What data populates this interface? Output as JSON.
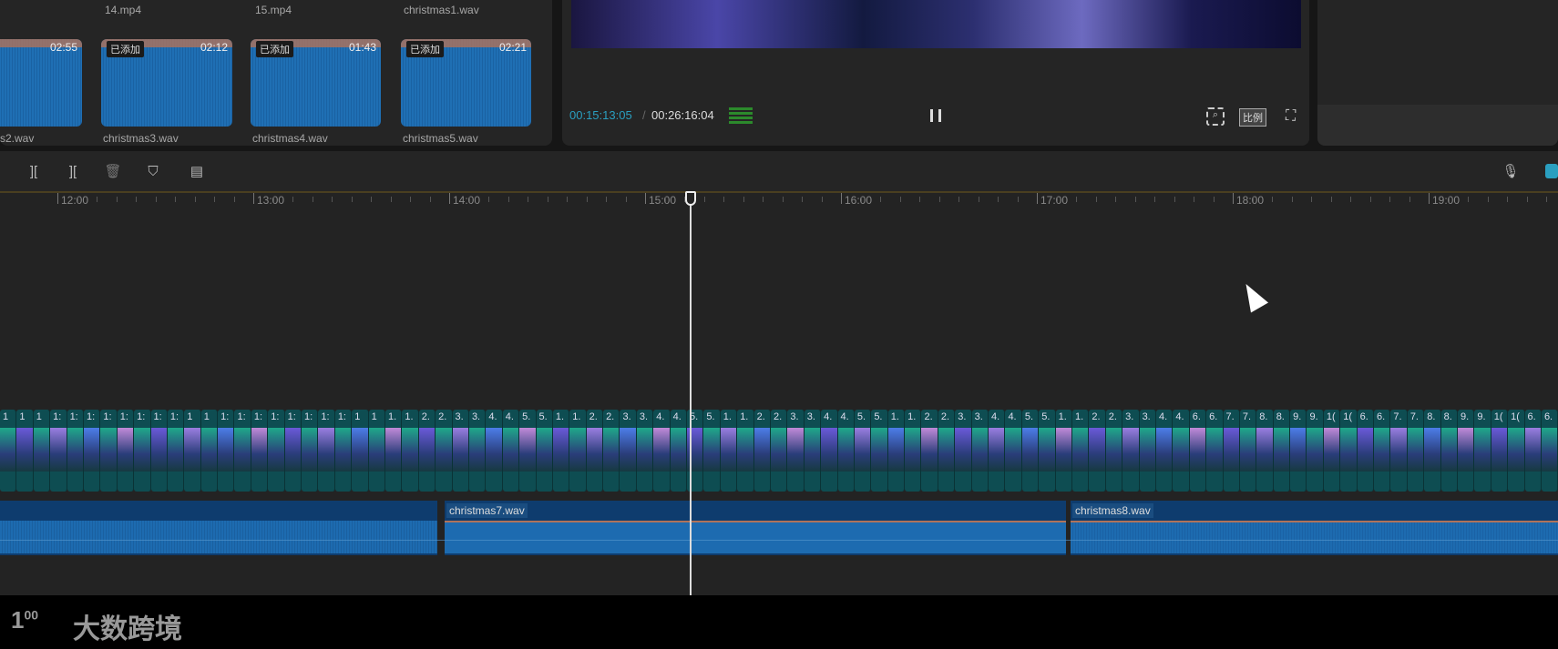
{
  "media": {
    "top_labels": [
      "14.mp4",
      "15.mp4",
      "christmas1.wav"
    ],
    "items": [
      {
        "name": "s2.wav",
        "duration": "02:55",
        "badge": ""
      },
      {
        "name": "christmas3.wav",
        "duration": "02:12",
        "badge": "已添加"
      },
      {
        "name": "christmas4.wav",
        "duration": "01:43",
        "badge": "已添加"
      },
      {
        "name": "christmas5.wav",
        "duration": "02:21",
        "badge": "已添加"
      }
    ]
  },
  "player": {
    "current_time": "00:15:13:05",
    "separator": "/",
    "total_time": "00:26:16:04",
    "ratio_label": "比例",
    "accent": "#2a9fc0"
  },
  "toolbar": {
    "icons": [
      "split-left-icon",
      "split-right-icon",
      "delete-icon",
      "marker-icon",
      "clear-icon"
    ]
  },
  "ruler": {
    "labels": [
      "12:00",
      "13:00",
      "14:00",
      "15:00",
      "16:00",
      "17:00",
      "18:00",
      "19:00"
    ]
  },
  "video_track": {
    "clip_labels": [
      "1",
      "1",
      "1",
      "1:",
      "1:",
      "1:",
      "1:",
      "1:",
      "1:",
      "1:",
      "1:",
      "1",
      "1",
      "1:",
      "1:",
      "1:",
      "1:",
      "1:",
      "1:",
      "1:",
      "1:",
      "1",
      "1",
      "1.",
      "1.",
      "2.",
      "2.",
      "3.",
      "3.",
      "4.",
      "4.",
      "5.",
      "5.",
      "1.",
      "1.",
      "2.",
      "2.",
      "3.",
      "3.",
      "4.",
      "4.",
      "5.",
      "5.",
      "1.",
      "1.",
      "2.",
      "2.",
      "3.",
      "3.",
      "4.",
      "4.",
      "5.",
      "5.",
      "1.",
      "1.",
      "2.",
      "2.",
      "3.",
      "3.",
      "4.",
      "4.",
      "5.",
      "5.",
      "1.",
      "1.",
      "2.",
      "2.",
      "3.",
      "3.",
      "4.",
      "4.",
      "6.",
      "6.",
      "7.",
      "7.",
      "8.",
      "8.",
      "9.",
      "9.",
      "1(",
      "1(",
      "6.",
      "6.",
      "7.",
      "7.",
      "8.",
      "8.",
      "9.",
      "9.",
      "1(",
      "1(",
      "6.",
      "6."
    ],
    "thumb_colors": [
      "#1fa88a",
      "#6a5ad8",
      "#1fa88a",
      "#9a7ee0",
      "#1fa88a",
      "#4c7de8",
      "#1fa88a",
      "#c08ad8"
    ]
  },
  "audio_track": {
    "clips": [
      {
        "name": "christmas7.wav"
      },
      {
        "name": "christmas8.wav"
      }
    ]
  },
  "watermark": {
    "text": "大数跨境",
    "logo": "100"
  }
}
